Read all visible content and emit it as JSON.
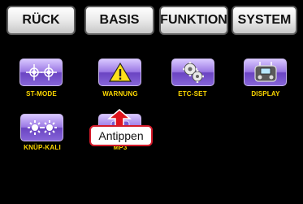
{
  "tabs": [
    {
      "label": "RÜCK"
    },
    {
      "label": "BASIS"
    },
    {
      "label": "FUNKTION"
    },
    {
      "label": "SYSTEM"
    }
  ],
  "menu_items": [
    {
      "label": "ST-MODE",
      "icon": "sticks-icon"
    },
    {
      "label": "WARNUNG",
      "icon": "warning-icon"
    },
    {
      "label": "ETC-SET",
      "icon": "gears-icon"
    },
    {
      "label": "DISPLAY",
      "icon": "transmitter-icon"
    },
    {
      "label": "KNÜP-KALI",
      "icon": "knueppel-icon"
    },
    {
      "label": "MP3",
      "icon": "mp3-icon"
    }
  ],
  "callout": {
    "text": "Antippen"
  },
  "colors": {
    "label": "#ffd900",
    "button": "#8a66dc",
    "callout_border": "#d41a2a",
    "background": "#000000"
  }
}
